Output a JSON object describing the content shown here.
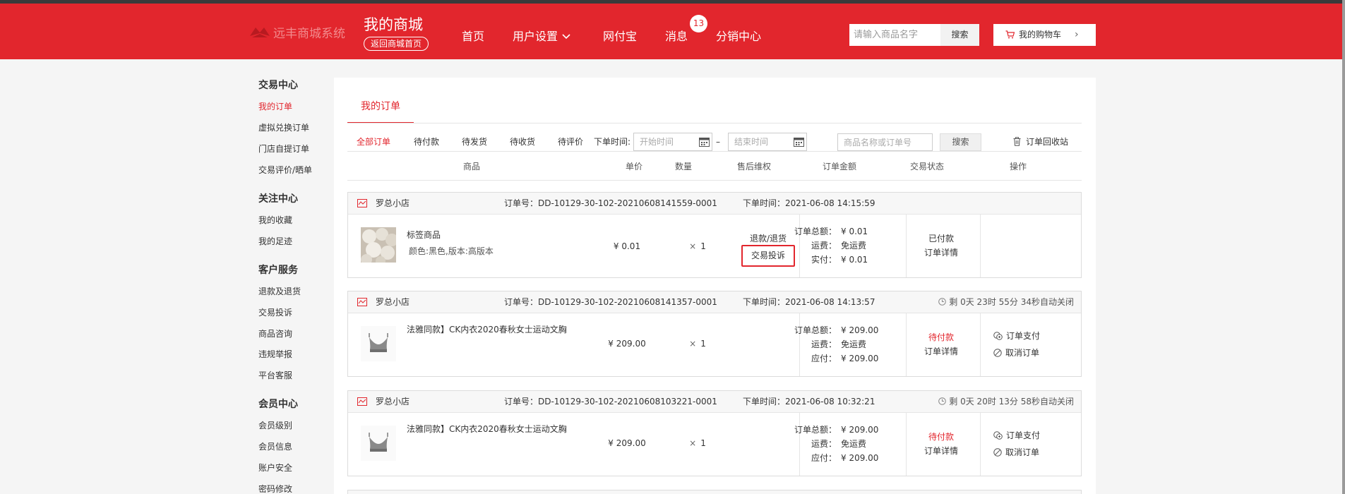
{
  "header": {
    "logo_text": "远丰商城系统",
    "brand_title": "我的商城",
    "back_link": "返回商城首页",
    "nav": [
      {
        "label": "首页"
      },
      {
        "label": "用户设置"
      },
      {
        "label": "网付宝"
      },
      {
        "label": "消息"
      },
      {
        "label": "分销中心"
      }
    ],
    "message_badge": "13",
    "search_placeholder": "请输入商品名字",
    "search_button": "搜索",
    "cart_label": "我的购物车"
  },
  "sidebar": {
    "groups": [
      {
        "title": "交易中心",
        "items": [
          "我的订单",
          "虚拟兑换订单",
          "门店自提订单",
          "交易评价/晒单"
        ]
      },
      {
        "title": "关注中心",
        "items": [
          "我的收藏",
          "我的足迹"
        ]
      },
      {
        "title": "客户服务",
        "items": [
          "退款及退货",
          "交易投诉",
          "商品咨询",
          "违规举报",
          "平台客服"
        ]
      },
      {
        "title": "会员中心",
        "items": [
          "会员级别",
          "会员信息",
          "账户安全",
          "密码修改"
        ]
      }
    ],
    "active_item": "我的订单"
  },
  "main": {
    "tab": "我的订单",
    "filters": [
      "全部订单",
      "待付款",
      "待发货",
      "待收货",
      "待评价"
    ],
    "date_label": "下单时间:",
    "date_start_placeholder": "开始时间",
    "date_end_placeholder": "结束时间",
    "date_separator": "–",
    "order_search_placeholder": "商品名称或订单号",
    "order_search_button": "搜索",
    "recycle_bin": "订单回收站",
    "columns": [
      "商品",
      "单价",
      "数量",
      "售后维权",
      "订单金额",
      "交易状态",
      "操作"
    ],
    "orders": [
      {
        "shop": "罗总小店",
        "order_no": "订单号：DD-10129-30-102-20210608141559-0001",
        "order_time": "下单时间：2021-06-08 14:15:59",
        "countdown": "",
        "product_name": "标签商品",
        "product_spec": "颜色:黑色,版本:高版本",
        "price": "¥ 0.01",
        "qty": "1",
        "aftersale_refund": "退款/退货",
        "aftersale_complain": "交易投诉",
        "amount_total_label": "订单总额：",
        "amount_total": "¥ 0.01",
        "shipping_label": "运费：",
        "shipping": "免运费",
        "paid_label": "实付：",
        "paid": "¥ 0.01",
        "status": "已付款",
        "detail": "订单详情",
        "ops": []
      },
      {
        "shop": "罗总小店",
        "order_no": "订单号：DD-10129-30-102-20210608141357-0001",
        "order_time": "下单时间：2021-06-08 14:13:57",
        "countdown": "剩 0天 23时 55分 34秒自动关闭",
        "product_name": "法雅同款】CK内衣2020春秋女士运动文胸",
        "product_spec": "",
        "price": "¥ 209.00",
        "qty": "1",
        "amount_total_label": "订单总额：",
        "amount_total": "¥ 209.00",
        "shipping_label": "运费：",
        "shipping": "免运费",
        "paid_label": "应付：",
        "paid": "¥ 209.00",
        "status": "待付款",
        "detail": "订单详情",
        "ops": [
          "订单支付",
          "取消订单"
        ]
      },
      {
        "shop": "罗总小店",
        "order_no": "订单号：DD-10129-30-102-20210608103221-0001",
        "order_time": "下单时间：2021-06-08 10:32:21",
        "countdown": "剩 0天 20时 13分 58秒自动关闭",
        "product_name": "法雅同款】CK内衣2020春秋女士运动文胸",
        "product_spec": "",
        "price": "¥ 209.00",
        "qty": "1",
        "amount_total_label": "订单总额：",
        "amount_total": "¥ 209.00",
        "shipping_label": "运费：",
        "shipping": "免运费",
        "paid_label": "应付：",
        "paid": "¥ 209.00",
        "status": "待付款",
        "detail": "订单详情",
        "ops": [
          "订单支付",
          "取消订单"
        ]
      }
    ]
  },
  "colors": {
    "brand_red": "#e2262d",
    "panel_bg": "#ffffff",
    "page_bg": "#f5f5f5"
  }
}
